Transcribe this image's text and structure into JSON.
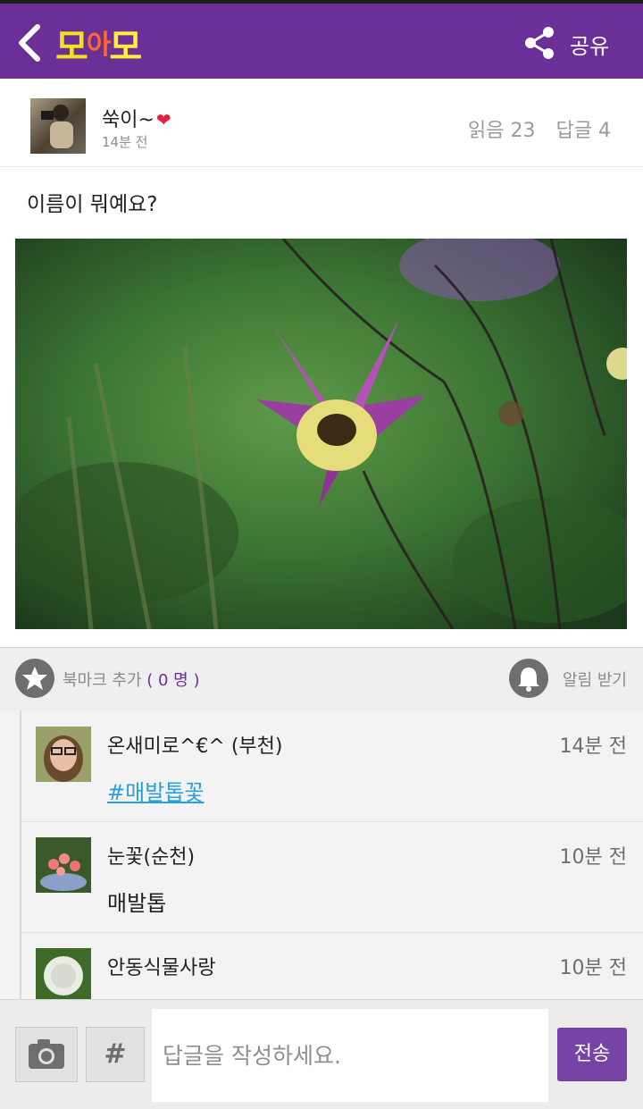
{
  "topbar": {
    "logo_text": [
      "모",
      "아",
      "모"
    ],
    "share_label": "공유",
    "bar_color": "#6b2f98"
  },
  "post": {
    "author": "쑥이~",
    "heart": "❤",
    "time": "14분 전",
    "reads": "읽음 23",
    "replies": "답글 4",
    "text": "이름이 뭐예요?"
  },
  "actions": {
    "bookmark_label": "북마크 추가",
    "bookmark_count": "( 0 명 )",
    "alarm_label": "알림 받기"
  },
  "comments": [
    {
      "name": "온새미로^€^  (부천)",
      "time": "14분 전",
      "body": "#매발톱꽃",
      "is_tag": true
    },
    {
      "name": "눈꽃(순천)",
      "time": "10분 전",
      "body": "매발톱",
      "is_tag": false
    },
    {
      "name": "안동식물사랑",
      "time": "10분 전",
      "body": "",
      "is_tag": false
    }
  ],
  "reply": {
    "hash_label": "#",
    "placeholder": "답글을 작성하세요.",
    "send_label": "전송"
  },
  "icons": {
    "back": "chevron-left-icon",
    "share": "share-icon",
    "bookmark": "star-icon",
    "alarm": "bell-icon",
    "camera": "camera-icon"
  }
}
